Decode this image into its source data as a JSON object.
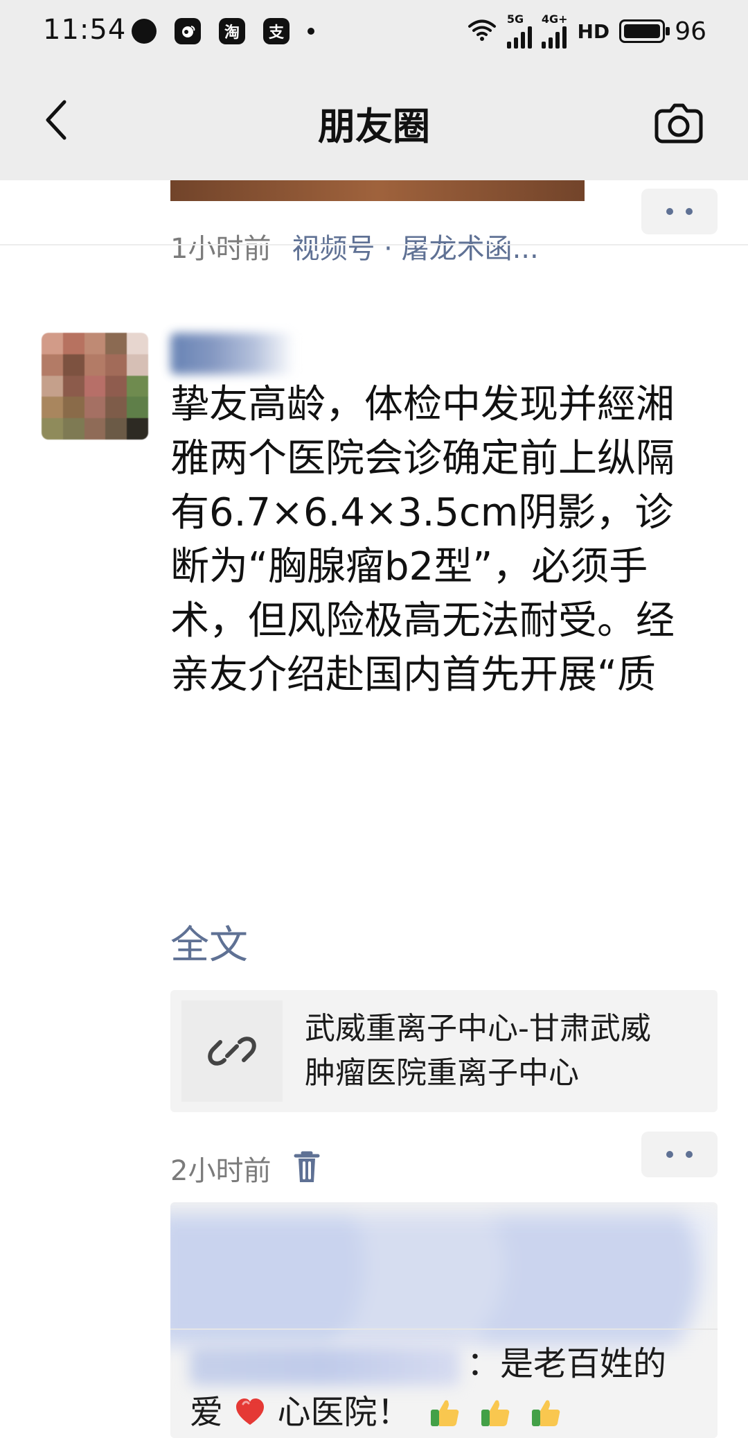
{
  "status_bar": {
    "time": "11:54",
    "left_icons": [
      "dot-icon",
      "weibo-icon",
      "taobao-icon",
      "alipay-icon",
      "small-dot-icon"
    ],
    "left_letters": [
      "",
      "",
      "淘",
      "支",
      ""
    ],
    "network": [
      "5G",
      "4G+"
    ],
    "hd": "HD",
    "battery_percent": "96"
  },
  "header": {
    "title": "朋友圈"
  },
  "feed": {
    "prev_post": {
      "time": "1小时前",
      "source": "视频号 · 屠龙术函..."
    },
    "post": {
      "text_lines": [
        "挚友高龄，体检中发现并經湘",
        "雅两个医院会诊确定前上纵隔",
        "有6.7×6.4×3.5cm阴影，诊",
        "断为“胸腺瘤b2型”，必须手",
        "术，但风险极高无法耐受。经",
        "亲友介绍赴国内首先开展“质"
      ],
      "full_text_label": "全文",
      "link_card": {
        "title_line1": "武威重离子中心-甘肃武威",
        "title_line2": "肿瘤医院重离子中心"
      },
      "time": "2小时前",
      "comment": {
        "text_before_heart": "：是老百姓的",
        "text_line2_prefix": "爱",
        "text_line2_suffix": "心医院！"
      }
    }
  },
  "colors": {
    "header_bg": "#ededed",
    "link_blue": "#5f7194",
    "meta_gray": "#7b7b7b"
  }
}
